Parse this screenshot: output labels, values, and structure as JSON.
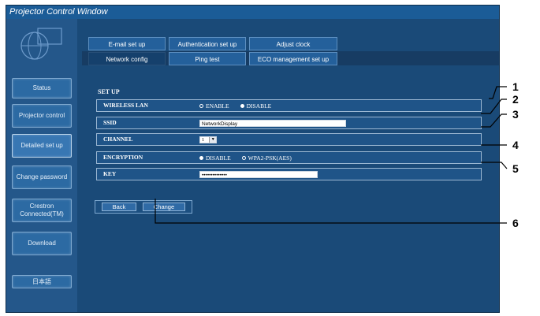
{
  "window": {
    "title": "Projector Control Window"
  },
  "sidebar": {
    "items": [
      {
        "label": "Status"
      },
      {
        "label": "Projector control"
      },
      {
        "label": "Detailed set up"
      },
      {
        "label": "Change password"
      },
      {
        "label": "Crestron Connected(TM)"
      },
      {
        "label": "Download"
      },
      {
        "label": "日本語"
      }
    ]
  },
  "tabs": {
    "row1": [
      {
        "label": "E-mail set up"
      },
      {
        "label": "Authentication set up"
      },
      {
        "label": "Adjust clock"
      }
    ],
    "row2": [
      {
        "label": "Network config"
      },
      {
        "label": "Ping test"
      },
      {
        "label": "ECO management set up"
      }
    ]
  },
  "setup": {
    "title": "SET UP",
    "wireless_lan": {
      "label": "WIRELESS LAN",
      "options": [
        "ENABLE",
        "DISABLE"
      ],
      "selected": "DISABLE"
    },
    "ssid": {
      "label": "SSID",
      "value": "NetworkDisplay"
    },
    "channel": {
      "label": "CHANNEL",
      "value": "1"
    },
    "encryption": {
      "label": "ENCRYPTION",
      "options": [
        "DISABLE",
        "WPA2-PSK(AES)"
      ],
      "selected": "DISABLE"
    },
    "key": {
      "label": "KEY",
      "value": "••••••••••••••"
    }
  },
  "actions": {
    "back": "Back",
    "change": "Change"
  },
  "callouts": [
    "1",
    "2",
    "3",
    "4",
    "5",
    "6"
  ]
}
